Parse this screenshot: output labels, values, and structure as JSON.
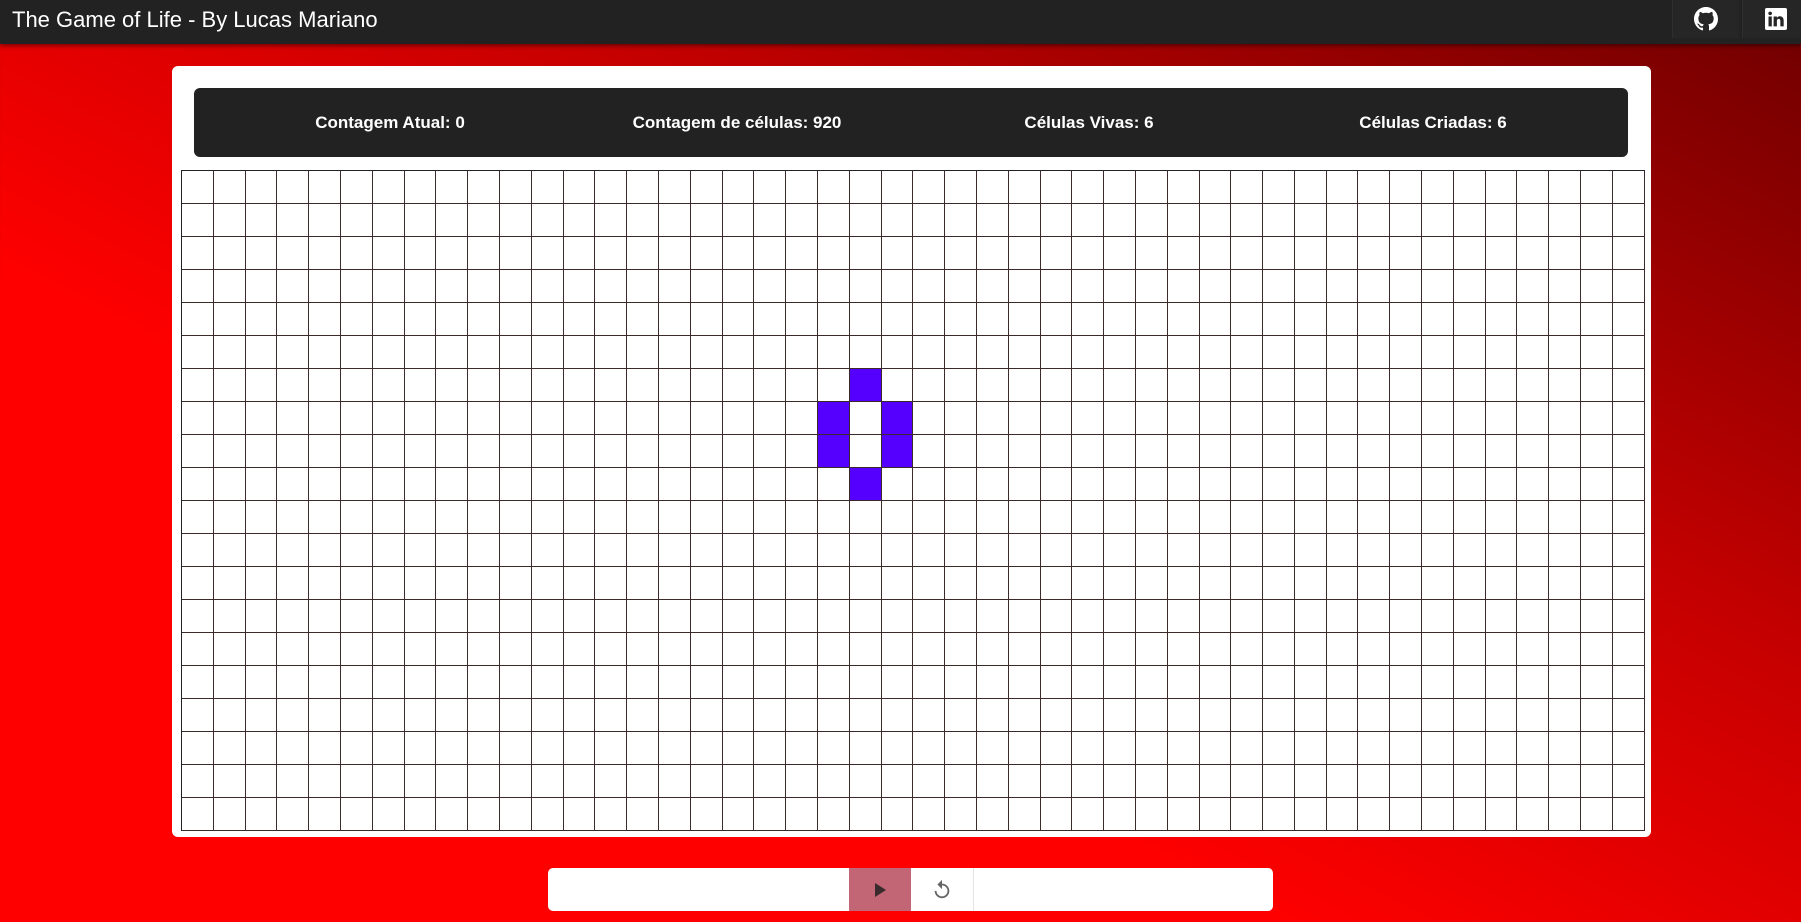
{
  "header": {
    "title": "The Game of Life - By Lucas Mariano",
    "github_icon": "github-icon",
    "linkedin_icon": "linkedin-icon"
  },
  "stats": {
    "current_count": "Contagem Atual: 0",
    "cell_count": "Contagem de células: 920",
    "alive_cells": "Células Vivas: 6",
    "created_cells": "Células Criadas: 6"
  },
  "grid": {
    "columns": 46,
    "rows": 20,
    "alive": [
      [
        6,
        21
      ],
      [
        7,
        20
      ],
      [
        7,
        22
      ],
      [
        8,
        20
      ],
      [
        8,
        22
      ],
      [
        9,
        21
      ]
    ]
  },
  "controls": {
    "play_icon": "play-icon",
    "reset_icon": "reset-icon"
  },
  "colors": {
    "alive_cell": "#5500ff",
    "topbar": "#222222",
    "stats_bar": "#222222",
    "play_button": "#c26675"
  }
}
